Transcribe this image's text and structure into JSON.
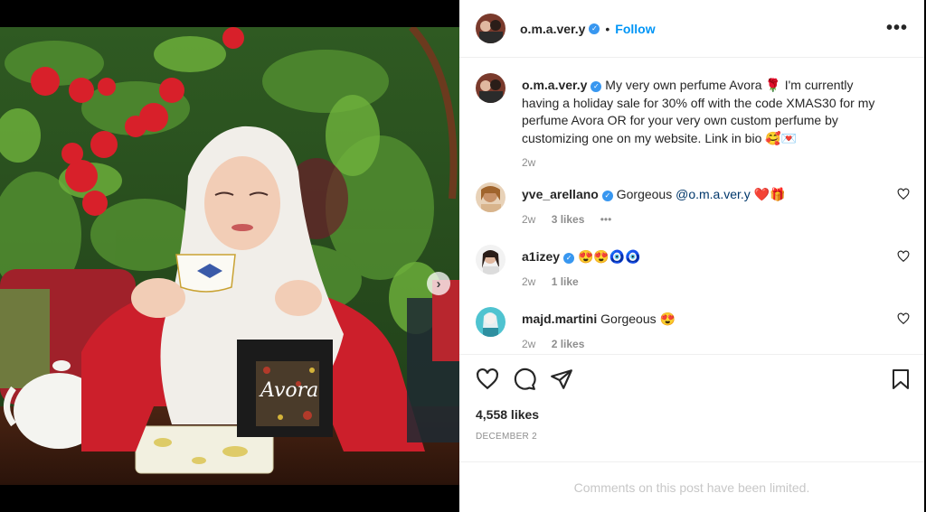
{
  "post": {
    "username": "o.m.a.ver.y",
    "follow_label": "Follow",
    "separator": "•",
    "more_label": "•••",
    "photo_text": "Avora"
  },
  "caption": {
    "username": "o.m.a.ver.y",
    "text": "My very own perfume Avora 🌹 I'm currently having a holiday sale for 30% off with the code XMAS30 for my perfume Avora OR for your very own custom perfume by customizing one on my website. Link in bio 🥰💌",
    "time": "2w"
  },
  "comments": [
    {
      "username": "yve_arellano",
      "verified": true,
      "text": "Gorgeous",
      "mention": "@o.m.a.ver.y",
      "emojis": [
        "❤️",
        "🎁"
      ],
      "time": "2w",
      "likes": "3 likes",
      "options": "•••"
    },
    {
      "username": "a1izey",
      "verified": true,
      "text": "",
      "mention": "",
      "emojis": [
        "😍",
        "😍",
        "🧿",
        "🧿"
      ],
      "time": "2w",
      "likes": "1 like",
      "options": ""
    },
    {
      "username": "majd.martini",
      "verified": false,
      "text": "Gorgeous",
      "mention": "",
      "emojis": [
        "😍"
      ],
      "time": "2w",
      "likes": "2 likes",
      "options": ""
    }
  ],
  "stats": {
    "likes": "4,558 likes",
    "date": "DECEMBER 2"
  },
  "footer": {
    "limited_text": "Comments on this post have been limited."
  },
  "colors": {
    "accent": "#0095f6",
    "verified": "#3897f0",
    "text": "#262626",
    "muted": "#8e8e8e"
  },
  "icons": [
    "verified-badge-icon",
    "more-options-icon",
    "heart-icon",
    "comment-icon",
    "share-icon",
    "bookmark-icon",
    "next-arrow-icon"
  ]
}
